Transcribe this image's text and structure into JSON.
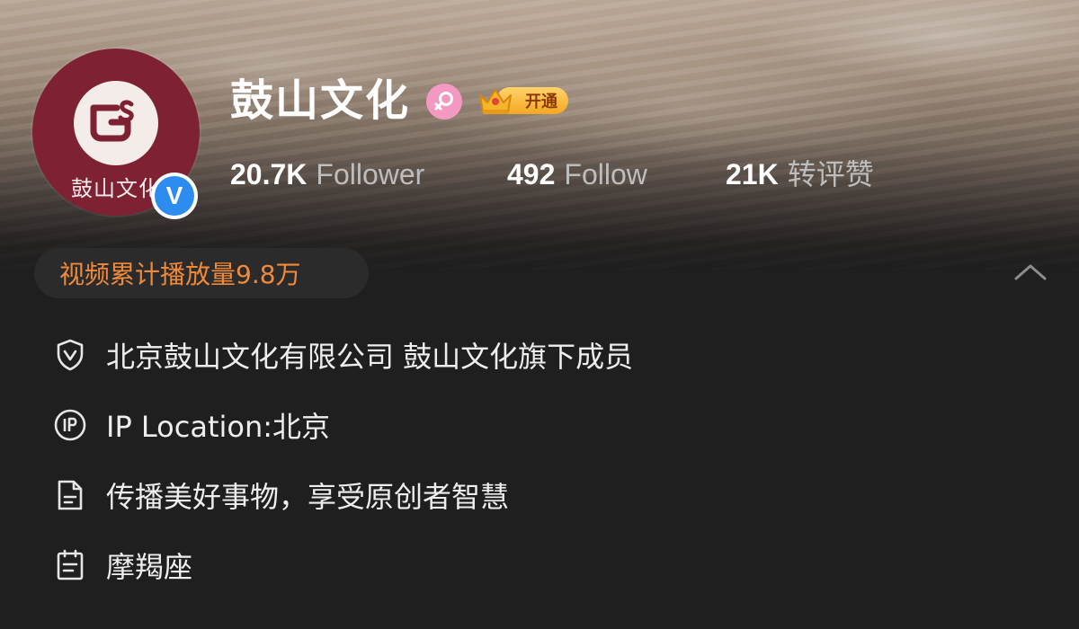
{
  "profile": {
    "name": "鼓山文化",
    "avatar_text": "鼓山文化",
    "verify_mark": "V",
    "vip_label": "开通",
    "gender_icon": "female-icon",
    "verify_icon": "blue-verified-icon"
  },
  "stats": [
    {
      "value": "20.7K",
      "label": "Follower"
    },
    {
      "value": "492",
      "label": "Follow"
    },
    {
      "value": "21K",
      "label": "转评赞"
    }
  ],
  "plays": {
    "text": "视频累计播放量9.8万"
  },
  "info": [
    {
      "icon": "shield-check-icon",
      "text": "北京鼓山文化有限公司 鼓山文化旗下成员"
    },
    {
      "icon": "ip-icon",
      "text": "IP Location:北京"
    },
    {
      "icon": "document-icon",
      "text": "传播美好事物，享受原创者智慧"
    },
    {
      "icon": "calendar-list-icon",
      "text": "摩羯座"
    }
  ],
  "colors": {
    "background": "#1f1f1f",
    "avatar_bg": "#7e2233",
    "verify_blue": "#2d8cf0",
    "plays_orange": "#f08a3a",
    "gender_pink": "#f49ac2",
    "vip_gold": "#f6a722"
  }
}
